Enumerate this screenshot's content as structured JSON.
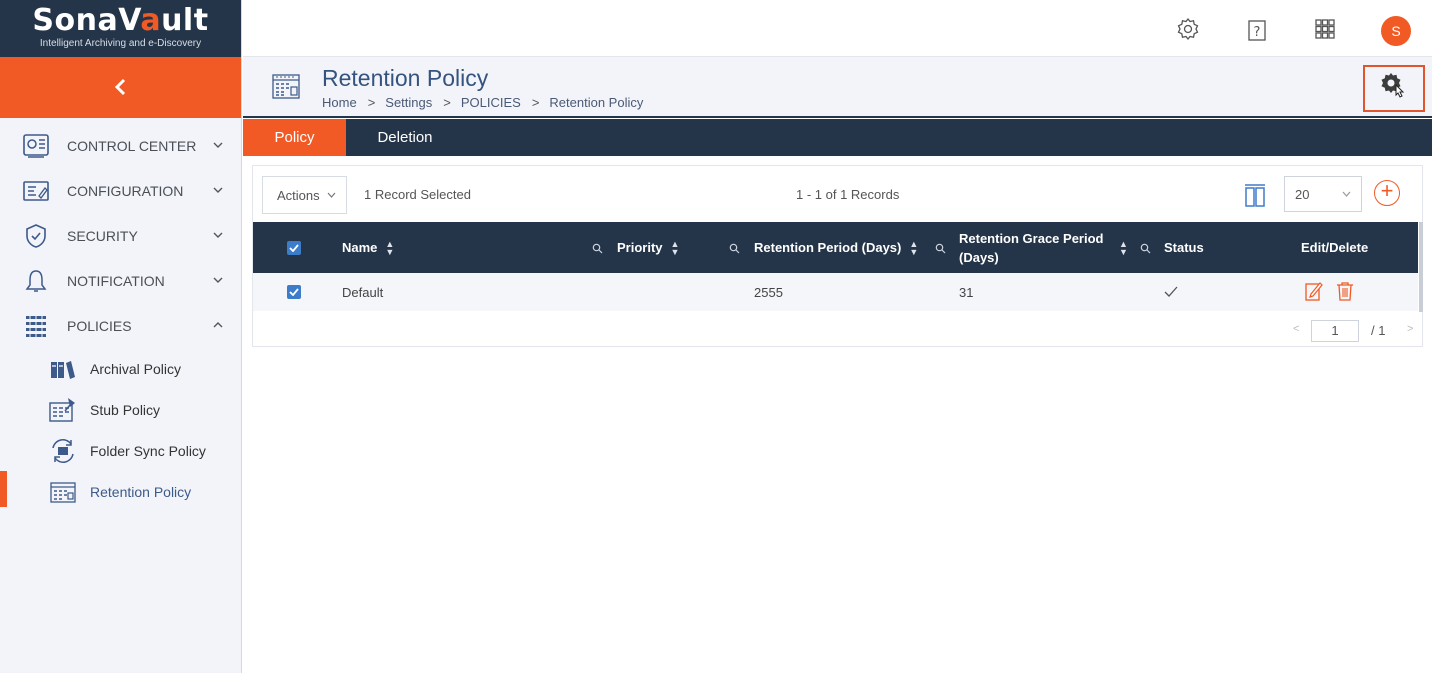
{
  "brand": {
    "name_part1": "SonaV",
    "name_lock": "a",
    "name_part2": "ult",
    "tagline": "Intelligent Archiving and e-Discovery"
  },
  "sidebar": {
    "collapse_icon": "chevron-left-icon",
    "items": [
      {
        "label": "CONTROL CENTER",
        "icon": "control-center-icon",
        "expanded": false
      },
      {
        "label": "CONFIGURATION",
        "icon": "configuration-icon",
        "expanded": false
      },
      {
        "label": "SECURITY",
        "icon": "shield-icon",
        "expanded": false
      },
      {
        "label": "NOTIFICATION",
        "icon": "bell-icon",
        "expanded": false
      },
      {
        "label": "POLICIES",
        "icon": "policies-icon",
        "expanded": true
      }
    ],
    "sub_items": [
      {
        "label": "Archival Policy",
        "icon": "archival-policy-icon"
      },
      {
        "label": "Stub Policy",
        "icon": "stub-policy-icon"
      },
      {
        "label": "Folder Sync Policy",
        "icon": "folder-sync-icon"
      },
      {
        "label": "Retention Policy",
        "icon": "retention-policy-icon",
        "active": true
      }
    ]
  },
  "topbar": {
    "avatar_initial": "S"
  },
  "page": {
    "title": "Retention Policy",
    "breadcrumb": [
      "Home",
      "Settings",
      "POLICIES",
      "Retention Policy"
    ]
  },
  "tabs": [
    {
      "label": "Policy",
      "active": true
    },
    {
      "label": "Deletion",
      "active": false
    }
  ],
  "toolbar": {
    "actions_label": "Actions",
    "selected_text": "1 Record Selected",
    "records_text": "1 - 1 of 1 Records",
    "page_size": "20"
  },
  "table": {
    "headers": {
      "name": "Name",
      "priority": "Priority",
      "retention_period": "Retention Period (Days)",
      "grace_line1": "Retention Grace Period",
      "grace_line2": "(Days)",
      "status": "Status",
      "edit_delete": "Edit/Delete"
    },
    "rows": [
      {
        "name": "Default",
        "priority": "",
        "retention_period": "2555",
        "grace_period": "31",
        "status": "✓",
        "selected": true
      }
    ]
  },
  "pager": {
    "current_page": "1",
    "total_text": "/ 1"
  },
  "colors": {
    "accent": "#f15a24",
    "navy": "#253549",
    "title_blue": "#34547f",
    "checkbox_blue": "#3d7cc9"
  }
}
